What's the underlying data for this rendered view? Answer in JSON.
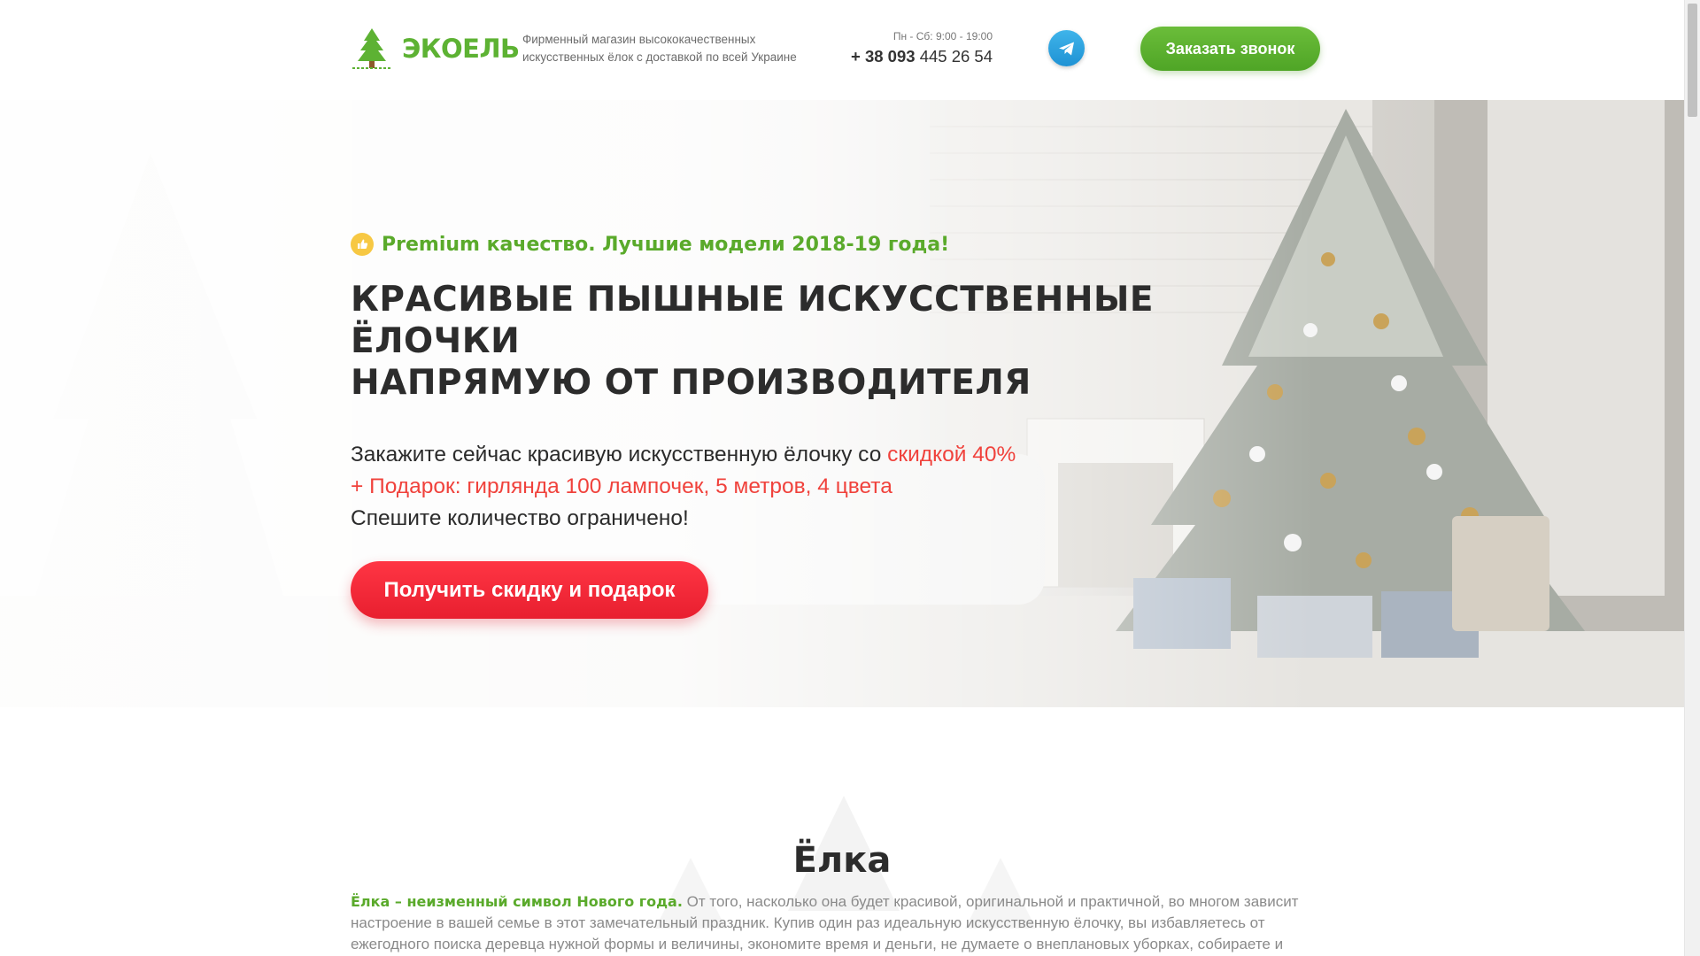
{
  "header": {
    "logo_text": "ЭКОЕЛЬ",
    "tagline": "Фирменный магазин высококачественных искусственных ёлок с доставкой по всей Украине",
    "hours": "Пн - Сб: 9:00 - 19:00",
    "phone_code": "+ 38 093",
    "phone_number": "445 26 54",
    "telegram_icon": "telegram-icon",
    "callback_label": "Заказать звонок"
  },
  "hero": {
    "premium_text": "Premium качество. Лучшие модели 2018-19 года!",
    "title_line1": "КРАСИВЫЕ ПЫШНЫЕ ИСКУССТВЕННЫЕ ЁЛОЧКИ",
    "title_line2": "НАПРЯМУЮ ОТ ПРОИЗВОДИТЕЛЯ",
    "offer_prefix": "Закажите сейчас красивую искусственную ёлочку со",
    "offer_discount": "скидкой 40%",
    "offer_gift": "+ Подарок: гирлянда 100 лампочек, 5 метров, 4 цвета",
    "offer_hurry": "Спешите количество ограничено!",
    "cta_label": "Получить скидку и подарок"
  },
  "section": {
    "title": "Ёлка",
    "lead": "Ёлка – неизменный символ Нового года.",
    "text": "От того, насколько она будет красивой, оригинальной и практичной, во многом зависит настроение в вашей семье в этот замечательный праздник. Купив один раз идеальную искусственную ёлочку, вы избавляетесь от ежегодного поиска деревца нужной формы и величины, экономите время и деньги, не думаете о внеплановых уборках, собираете и разбираете ёлку без особых"
  },
  "colors": {
    "brand_green": "#5db233",
    "accent_red": "#f0423c",
    "button_red": "#ff2f3f",
    "telegram_blue": "#2aa1de"
  }
}
